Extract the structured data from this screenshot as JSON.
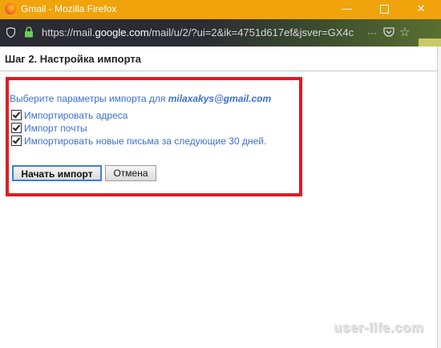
{
  "window": {
    "title": "Gmail - Mozilla Firefox",
    "controls": {
      "minimize": "—",
      "close": "✕"
    }
  },
  "browser": {
    "url_prefix": "https://mail.",
    "url_domain": "google.com",
    "url_path": "/mail/u/2/?ui=2&ik=4751d617ef&jsver=GX4c",
    "page_actions_label": "···"
  },
  "dialog": {
    "title": "Шаг 2. Настройка импорта",
    "prompt": "Выберите параметры импорта для ",
    "email": "milaxakys@gmail.com",
    "options": [
      {
        "label": "Импортировать адреса",
        "checked": true
      },
      {
        "label": "Импорт почты",
        "checked": true
      },
      {
        "label": "Импортировать новые письма за следующие 30 дней.",
        "checked": true
      }
    ],
    "start_button": "Начать импорт",
    "cancel_button": "Отмена"
  },
  "watermark": "user-life.com",
  "colors": {
    "titlebar": "#f0a30a",
    "highlight_box": "#e01a22",
    "link_text": "#3b6fd1"
  }
}
